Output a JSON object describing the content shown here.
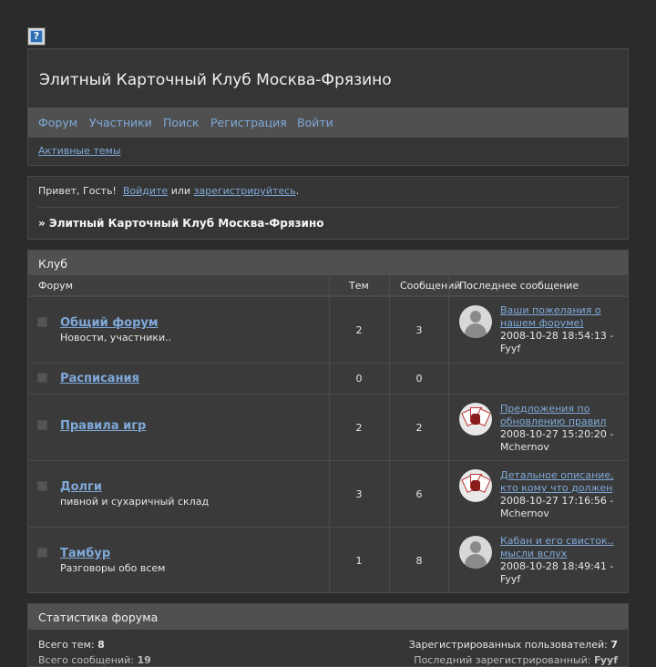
{
  "help_icon_glyph": "?",
  "header": {
    "title": "Элитный Карточный Клуб Москва-Фрязино",
    "nav": [
      "Форум",
      "Участники",
      "Поиск",
      "Регистрация",
      "Войти"
    ],
    "active_topics": "Активные темы"
  },
  "welcome": {
    "greeting": "Привет, Гость!",
    "login_link": "Войдите",
    "or": "или",
    "register_link": "зарегистрируйтесь",
    "dot": ".",
    "crumb": "» Элитный Карточный Клуб Москва-Фрязино"
  },
  "category": {
    "title": "Клуб",
    "columns": {
      "forum": "Форум",
      "topics": "Тем",
      "posts": "Сообщений",
      "last_post": "Последнее сообщение"
    },
    "forums": [
      {
        "name": "Общий форум",
        "desc": "Новости, участники..",
        "topics": "2",
        "posts": "3",
        "last_title": "Ваши пожелания о нашем форуме)",
        "last_date": "2008-10-28 18:54:13 -",
        "last_user": "Fyyf",
        "avatar": "generic-avatar-icon"
      },
      {
        "name": "Расписания",
        "desc": "",
        "topics": "0",
        "posts": "0",
        "last_title": "",
        "last_date": "",
        "last_user": "",
        "avatar": ""
      },
      {
        "name": "Правила игр",
        "desc": "",
        "topics": "2",
        "posts": "2",
        "last_title": "Предложения по обновлению правил",
        "last_date": "2008-10-27 15:20:20 -",
        "last_user": "Mchernov",
        "avatar": "playing-cards-avatar-icon"
      },
      {
        "name": "Долги",
        "desc": "пивной и сухаричный склад",
        "topics": "3",
        "posts": "6",
        "last_title": "Детальное описание, кто кому что должен",
        "last_date": "2008-10-27 17:16:56 -",
        "last_user": "Mchernov",
        "avatar": "playing-cards-avatar-icon"
      },
      {
        "name": "Тамбур",
        "desc": "Разговоры обо всем",
        "topics": "1",
        "posts": "8",
        "last_title": "Кабан и его свисток.. мысли вслух",
        "last_date": "2008-10-28 18:49:41 -",
        "last_user": "Fyyf",
        "avatar": "generic-avatar-icon"
      }
    ]
  },
  "stats": {
    "title": "Статистика форума",
    "total_topics_label": "Всего тем:",
    "total_topics": "8",
    "registered_label": "Зарегистрированных пользователей:",
    "registered": "7",
    "total_posts_label": "Всего сообщений:",
    "total_posts": "19",
    "newest_label": "Последний зарегистрированный:",
    "newest": "Fyyf"
  },
  "colors": {
    "background": "#2b2b2b",
    "panel": "#353535",
    "bar": "#505050",
    "link": "#7fa9d9"
  }
}
